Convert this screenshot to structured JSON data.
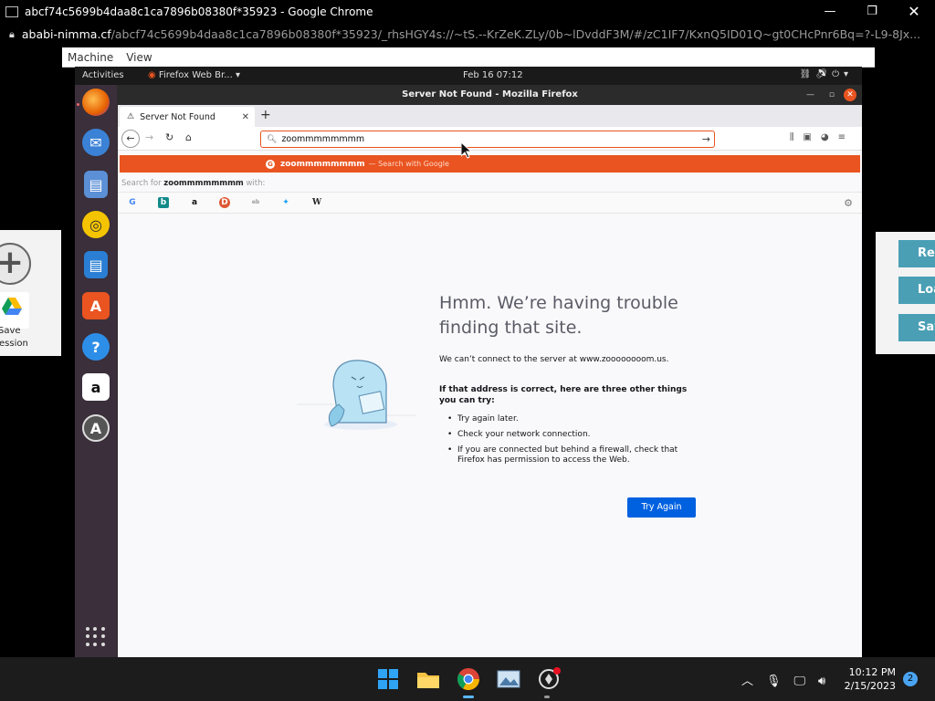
{
  "chrome": {
    "title": "abcf74c5699b4daa8c1ca7896b08380f*35923 - Google Chrome",
    "url_domain": "ababi-nimma.cf",
    "url_path": "/abcf74c5699b4daa8c1ca7896b08380f*35923/_rhsHGY4s://~tS.--KrZeK.ZLy/0b~lDvddF3M/#/zC1IF7/KxnQ5ID01Q~gt0CHcPnr6Bq=?-L9-8Jx..."
  },
  "guac_menu": {
    "machine": "Machine",
    "view": "View"
  },
  "left_panel": {
    "save_label_1": "Save",
    "save_label_2": "ession"
  },
  "right_panel": {
    "btn1": "Re",
    "btn2": "Loa",
    "btn3": "Sav"
  },
  "ubuntu_topbar": {
    "activities": "Activities",
    "app_menu": "Firefox Web Br...",
    "clock": "Feb 16  07:12"
  },
  "firefox": {
    "window_title": "Server Not Found - Mozilla Firefox",
    "tab_title": "Server Not Found",
    "url_value": "zoommmmmmmm",
    "suggestion_term": "zoommmmmmmm",
    "suggestion_hint": "— Search with Google",
    "search_for_prefix": "Search for",
    "search_for_term": "zoommmmmmmm",
    "search_for_suffix": "with:",
    "error": {
      "title": "Hmm. We’re having trouble finding that site.",
      "lead": "We can’t connect to the server at www.zoooooooom.us.",
      "sub": "If that address is correct, here are three other things you can try:",
      "tips": [
        "Try again later.",
        "Check your network connection.",
        "If you are connected but behind a firewall, check that Firefox has permission to access the Web."
      ],
      "button": "Try Again"
    }
  },
  "taskbar": {
    "time": "10:12 PM",
    "date": "2/15/2023",
    "notification_count": "2"
  },
  "colors": {
    "ubuntu_orange": "#e95420",
    "firefox_blue": "#0061e0",
    "guac_button": "#4a9fb5"
  }
}
